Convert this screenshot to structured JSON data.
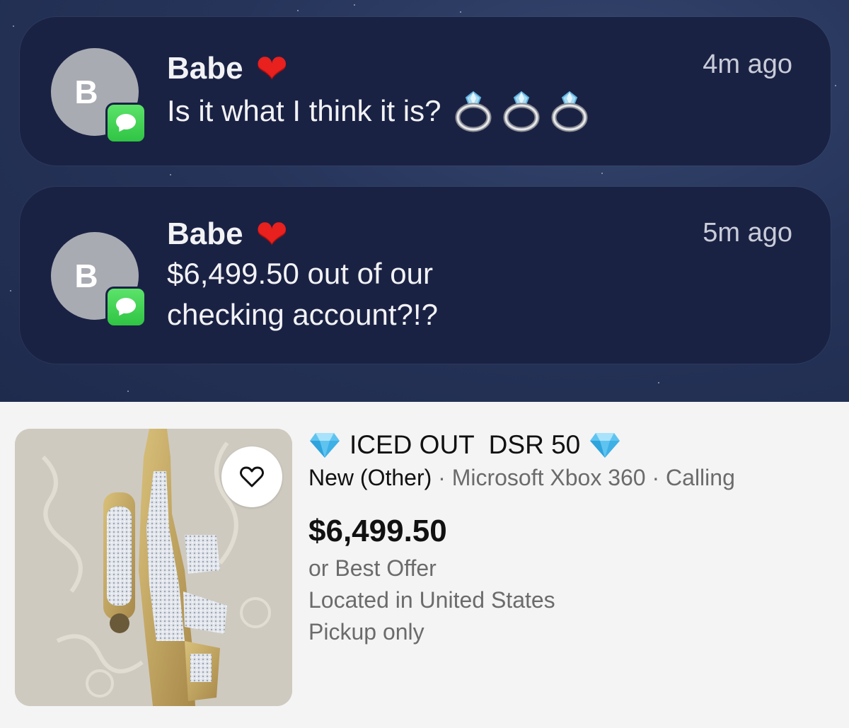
{
  "notifications": [
    {
      "avatar_initial": "B",
      "sender": "Babe",
      "sender_emoji": "❤",
      "time": "4m ago",
      "message": "Is it what I think it is?",
      "message_emoji": [
        "ring-icon",
        "ring-icon",
        "ring-icon"
      ],
      "app_icon": "messages-icon"
    },
    {
      "avatar_initial": "B",
      "sender": "Babe",
      "sender_emoji": "❤",
      "time": "5m ago",
      "message": "$6,499.50 out of our checking account?!?",
      "app_icon": "messages-icon"
    }
  ],
  "listing": {
    "title": "ICED OUT  DSR 50",
    "title_emoji": "gem-icon",
    "condition": "New (Other)",
    "separator": " · ",
    "platform": "Microsoft Xbox 360",
    "category": "Calling",
    "price": "$6,499.50",
    "offer": "or Best Offer",
    "location": "Located in United States",
    "shipping": "Pickup only",
    "watch_icon": "heart-outline-icon"
  },
  "colors": {
    "notification_bg": "#1a2244",
    "heart": "#e8201e",
    "messages_green": "#34c84a",
    "price_text": "#111111",
    "muted_text": "#6b6b6b"
  }
}
